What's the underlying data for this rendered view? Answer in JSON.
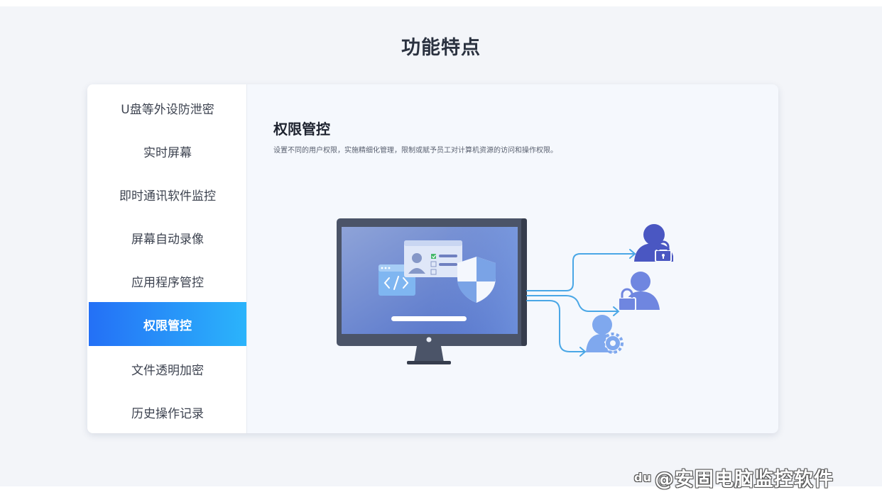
{
  "section": {
    "title": "功能特点"
  },
  "sidebar": {
    "items": [
      {
        "label": "U盘等外设防泄密",
        "active": false
      },
      {
        "label": "实时屏幕",
        "active": false
      },
      {
        "label": "即时通讯软件监控",
        "active": false
      },
      {
        "label": "屏幕自动录像",
        "active": false
      },
      {
        "label": "应用程序管控",
        "active": false
      },
      {
        "label": "权限管控",
        "active": true
      },
      {
        "label": "文件透明加密",
        "active": false
      },
      {
        "label": "历史操作记录",
        "active": false
      }
    ]
  },
  "content": {
    "title": "权限管控",
    "description": "设置不同的用户权限，实施精细化管理，限制或赋予员工对计算机资源的访问和操作权限。"
  },
  "illustration": {
    "icons": [
      "monitor-icon",
      "code-window-icon",
      "id-card-icon",
      "shield-icon",
      "user-locked-icon",
      "user-padlock-icon",
      "user-settings-icon"
    ]
  },
  "watermark": {
    "logo": "du",
    "text": "@安固电脑监控软件"
  },
  "colors": {
    "accent_start": "#2470f6",
    "accent_end": "#2bb4fb",
    "user_dark": "#4a57c2",
    "user_mid": "#6f86e0",
    "user_light": "#7fa8ee",
    "arrow": "#4aa7e6"
  }
}
